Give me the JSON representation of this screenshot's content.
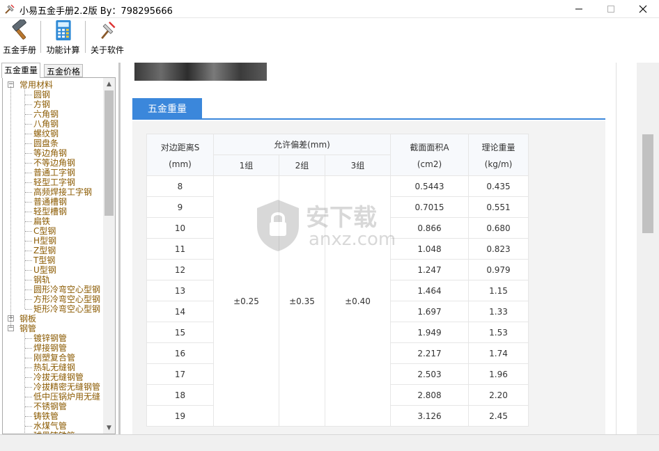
{
  "window": {
    "title": "小易五金手册2.2版 By：798295666",
    "minimize": "—",
    "maximize": "☐",
    "close": "✕"
  },
  "toolbar": {
    "items": [
      {
        "label": "五金手册",
        "icon": "hammer-icon"
      },
      {
        "label": "功能计算",
        "icon": "calculator-icon"
      },
      {
        "label": "关于软件",
        "icon": "about-icon"
      }
    ]
  },
  "left_tabs": [
    "五金重量",
    "五金价格"
  ],
  "tree": {
    "groups": [
      {
        "label": "常用材料",
        "expanded": true,
        "exp_symbol": "−",
        "children": [
          "圆钢",
          "方钢",
          "六角钢",
          "八角钢",
          "螺纹钢",
          "圆盘条",
          "等边角钢",
          "不等边角钢",
          "普通工字钢",
          "轻型工字钢",
          "高频焊接工字钢",
          "普通槽钢",
          "轻型槽钢",
          "扁铁",
          "C型钢",
          "H型钢",
          "Z型钢",
          "T型钢",
          "U型钢",
          "钢轨",
          "圆形冷弯空心型钢",
          "方形冷弯空心型钢",
          "矩形冷弯空心型钢"
        ]
      },
      {
        "label": "钢板",
        "expanded": false,
        "exp_symbol": "+",
        "children": []
      },
      {
        "label": "钢管",
        "expanded": true,
        "exp_symbol": "−",
        "children": [
          "镀锌钢管",
          "焊接钢管",
          "刚塑复合管",
          "热轧无缝钢",
          "冷拔无缝钢管",
          "冷拔精密无缝钢管",
          "低中压锅炉用无缝",
          "不锈钢管",
          "铸铁管",
          "水煤气管",
          "球墨铸铁管"
        ]
      }
    ]
  },
  "section": {
    "title": "五金重量"
  },
  "table": {
    "headers": {
      "col1_line1": "对边距离S",
      "col1_line2": "(mm)",
      "tolerance": "允许偏差(mm)",
      "group1": "1组",
      "group2": "2组",
      "group3": "3组",
      "area_line1": "截面面积A",
      "area_line2": "(cm2)",
      "weight_line1": "理论重量",
      "weight_line2": "(kg/m)"
    },
    "tolerances": [
      "±0.25",
      "±0.35",
      "±0.40"
    ],
    "rows": [
      {
        "s": "8",
        "area": "0.5443",
        "weight": "0.435"
      },
      {
        "s": "9",
        "area": "0.7015",
        "weight": "0.551"
      },
      {
        "s": "10",
        "area": "0.866",
        "weight": "0.680"
      },
      {
        "s": "11",
        "area": "1.048",
        "weight": "0.823"
      },
      {
        "s": "12",
        "area": "1.247",
        "weight": "0.979"
      },
      {
        "s": "13",
        "area": "1.464",
        "weight": "1.15"
      },
      {
        "s": "14",
        "area": "1.697",
        "weight": "1.33"
      },
      {
        "s": "15",
        "area": "1.949",
        "weight": "1.53"
      },
      {
        "s": "16",
        "area": "2.217",
        "weight": "1.74"
      },
      {
        "s": "17",
        "area": "2.503",
        "weight": "1.96"
      },
      {
        "s": "18",
        "area": "2.808",
        "weight": "2.20"
      },
      {
        "s": "19",
        "area": "3.126",
        "weight": "2.45"
      }
    ]
  },
  "watermark": {
    "text": "安下载",
    "sub": "anxz.com"
  },
  "colors": {
    "accent": "#3b87db",
    "tree_text": "#8b5a00"
  }
}
